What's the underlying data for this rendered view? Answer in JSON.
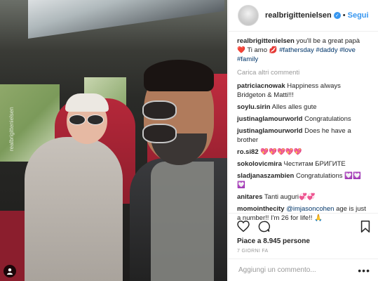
{
  "photo": {
    "watermark": "realbrigittenielsen",
    "user_tag_icon": "person-icon"
  },
  "header": {
    "username": "realbrigittenielsen",
    "verified_icon": "verified-badge-icon",
    "separator": "•",
    "follow_label": "Segui"
  },
  "caption": {
    "username": "realbrigittenielsen",
    "text_1": "you'll be a great papà",
    "heart": "❤️",
    "text_2": "Ti amo",
    "kiss": "💋",
    "hashtags": [
      "#fathersday",
      "#daddy",
      "#love",
      "#family"
    ]
  },
  "load_more": "Carica altri commenti",
  "comments": [
    {
      "user": "patriciacnowak",
      "text": "Happiness always Bridgeton & Matti!!!"
    },
    {
      "user": "soylu.sirin",
      "text": "Alles alles gute"
    },
    {
      "user": "justinaglamourworld",
      "text": "Congratulations"
    },
    {
      "user": "justinaglamourworld",
      "text": "Does he have a brother"
    },
    {
      "user": "ro.si82",
      "text": "💖💖💖💖💖"
    },
    {
      "user": "sokolovicmira",
      "text": "Честитам БРИГИТЕ"
    },
    {
      "user": "sladjanaszambien",
      "text": "Congratulations 💟💟 💟"
    },
    {
      "user": "anitares",
      "text": "Tanti auguri💞💞"
    },
    {
      "user": "momointhecity",
      "mention": "@imjasoncohen",
      "text": "age is just a number!! I'm 26 for life!! 🙏"
    }
  ],
  "actions": {
    "like_icon": "heart-outline-icon",
    "comment_icon": "comment-bubble-icon",
    "save_icon": "bookmark-icon"
  },
  "likes": "Piace a 8.945 persone",
  "time_ago": "7 GIORNI FA",
  "add_comment": {
    "placeholder": "Aggiungi un commento...",
    "more": "•••"
  }
}
